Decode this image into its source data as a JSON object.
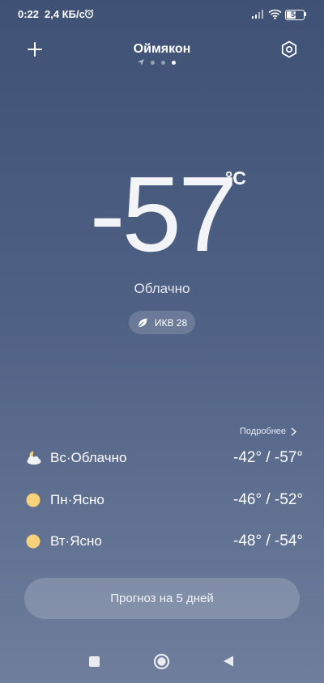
{
  "status_bar": {
    "time": "0:22",
    "speed": "2,4 КБ/с",
    "battery": "56"
  },
  "header": {
    "city": "Оймякон"
  },
  "current": {
    "temperature": "-57",
    "unit": "°C",
    "condition": "Облачно",
    "aqi_label": "ИКВ 28"
  },
  "forecast": {
    "details_label": "Подробнее",
    "days": [
      {
        "label": "Вс·Облачно",
        "temps": "-42° / -57°",
        "icon": "partly-cloudy-night-icon"
      },
      {
        "label": "Пн·Ясно",
        "temps": "-46° / -52°",
        "icon": "sun-icon"
      },
      {
        "label": "Вт·Ясно",
        "temps": "-48° / -54°",
        "icon": "sun-icon"
      }
    ],
    "button_label": "Прогноз на 5 дней"
  },
  "colors": {
    "background_top": "#3f5275",
    "background_bottom": "#6f7e9c",
    "sun": "#f8d27a"
  }
}
